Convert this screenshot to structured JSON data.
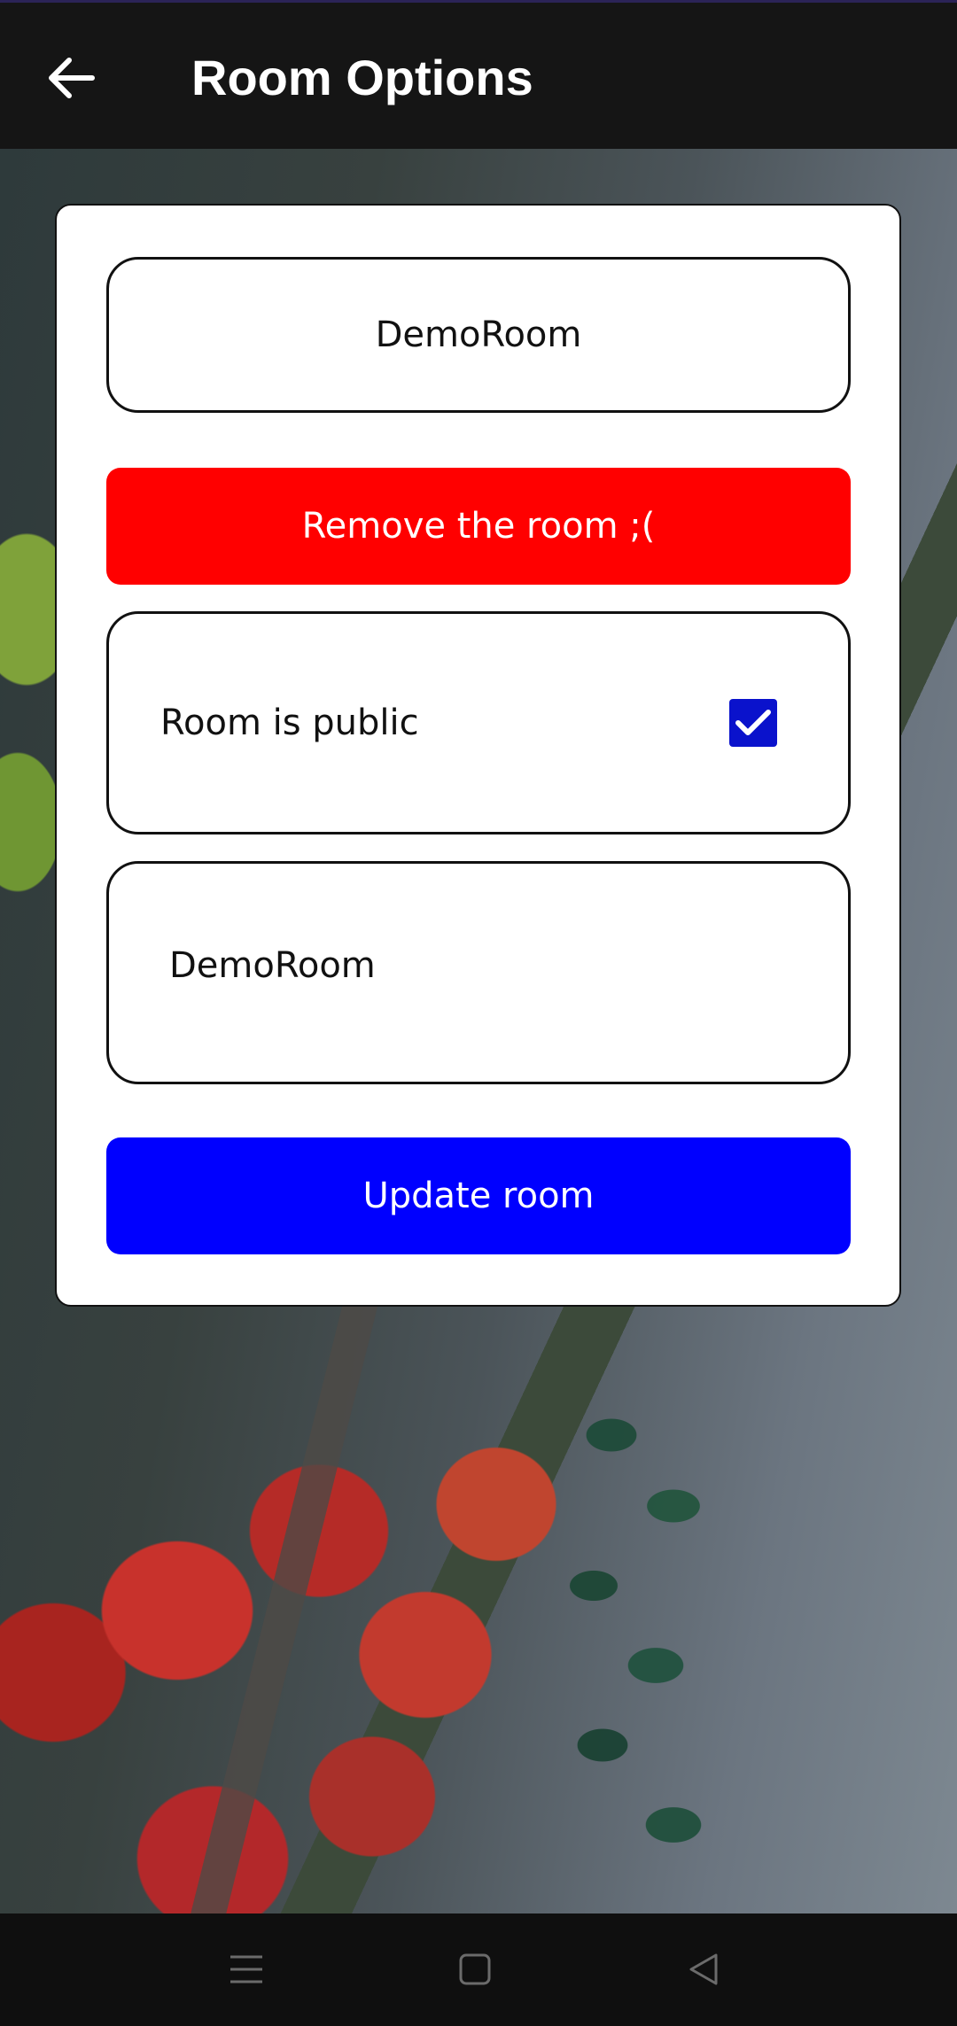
{
  "app_bar": {
    "title": "Room Options",
    "back_icon": "arrow-left-icon"
  },
  "form": {
    "room_name_value": "DemoRoom",
    "remove_button_label": "Remove the room ;(",
    "public_label": "Room is public",
    "public_checked": true,
    "room_description_value": "DemoRoom",
    "update_button_label": "Update room"
  },
  "colors": {
    "remove_button": "#ff0000",
    "update_button": "#0000ff",
    "checkbox": "#0a12cc",
    "app_bar": "#151515"
  },
  "nav_bar": {
    "icons": [
      "menu-icon",
      "home-icon",
      "back-triangle-icon"
    ]
  }
}
